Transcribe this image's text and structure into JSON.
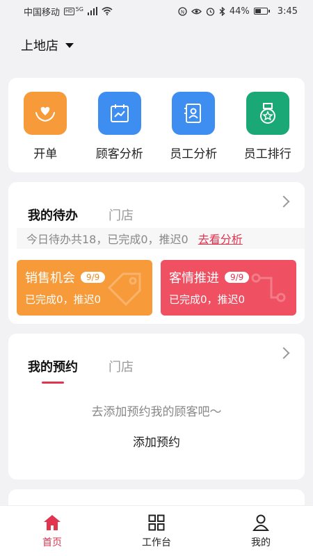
{
  "status_bar": {
    "carrier": "中国移动",
    "hd": "HD",
    "network": "5G",
    "battery_text": "44%",
    "battery_level": 0.44,
    "time": "3:45"
  },
  "store": {
    "name": "上地店"
  },
  "quick_actions": [
    {
      "label": "开单",
      "icon": "heart-hands-icon",
      "color": "#f79a3a"
    },
    {
      "label": "顾客分析",
      "icon": "calendar-chart-icon",
      "color": "#3d8ef0"
    },
    {
      "label": "员工分析",
      "icon": "id-card-icon",
      "color": "#3d8ef0"
    },
    {
      "label": "员工排行",
      "icon": "medal-icon",
      "color": "#1aa876"
    }
  ],
  "todo": {
    "tabs": [
      "我的待办",
      "门店"
    ],
    "summary": "今日待办共18，已完成0，推迟0",
    "link": "去看分析",
    "tiles": [
      {
        "title": "销售机会",
        "badge": "9/9",
        "sub": "已完成0，推迟0"
      },
      {
        "title": "客情推进",
        "badge": "9/9",
        "sub": "已完成0，推迟0"
      }
    ]
  },
  "appointments": {
    "tabs": [
      "我的预约",
      "门店"
    ],
    "empty_text": "去添加预约我的顾客吧～",
    "add_label": "添加预约"
  },
  "bottom_nav": [
    {
      "label": "首页",
      "icon": "home-icon"
    },
    {
      "label": "工作台",
      "icon": "grid-icon"
    },
    {
      "label": "我的",
      "icon": "user-icon"
    }
  ],
  "colors": {
    "accent": "#e0344f",
    "orange": "#f79a3a",
    "blue": "#3d8ef0",
    "green": "#1aa876",
    "red_tile": "#ef5062"
  }
}
